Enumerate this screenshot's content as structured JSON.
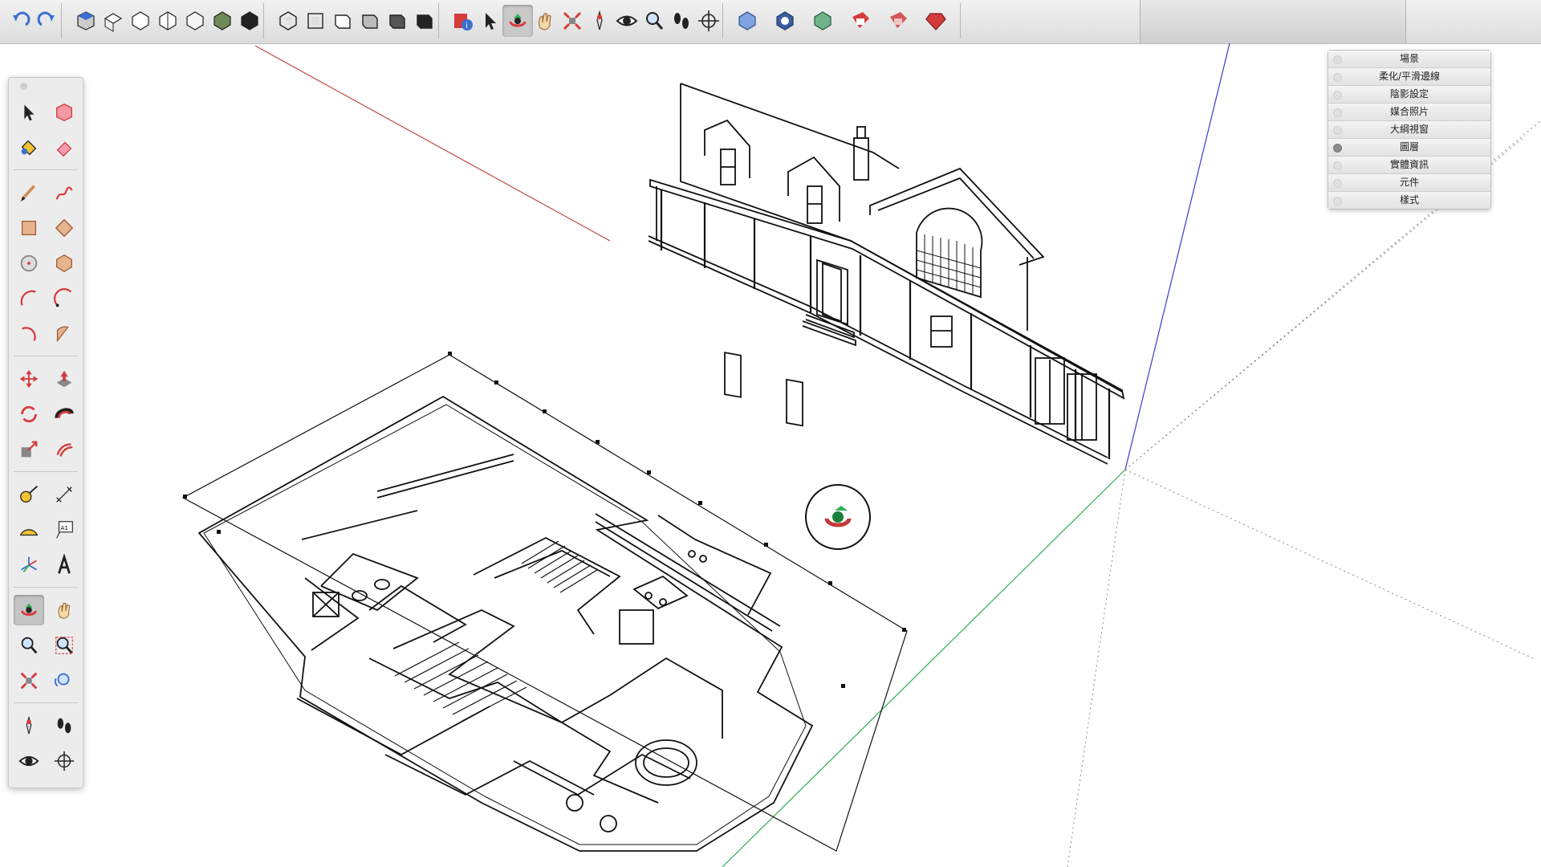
{
  "colors": {
    "red_axis": "#c04a4a",
    "green_axis": "#2fae55",
    "blue_axis": "#3a3ad0",
    "toolbar_bg": "#e2e2e2"
  },
  "toolbar": {
    "groups": [
      [
        "undo-icon",
        "redo-icon"
      ],
      [
        "iso-view-icon",
        "top-view-icon",
        "front-view-icon",
        "right-view-icon",
        "back-view-icon",
        "left-view-icon",
        "bottom-view-icon"
      ],
      [
        "x-ray-icon",
        "wireframe-icon",
        "hidden-line-icon",
        "shaded-icon",
        "shaded-textures-icon",
        "monochrome-icon"
      ],
      [
        "model-info-icon",
        "select-icon",
        "orbit-icon",
        "pan-icon",
        "zoom-extents-icon",
        "position-camera-icon",
        "look-around-icon",
        "zoom-icon",
        "walk-icon",
        "position-target-icon"
      ],
      [
        "3d-warehouse-icon",
        "share-model-icon",
        "extension-warehouse-icon",
        "layout-icon",
        "send-to-layout-icon",
        "ruby-console-icon"
      ],
      [
        "shadows-icon",
        "display-icon",
        "styles-icon",
        "fog-icon",
        "settings-icon",
        "components-icon",
        "tips-icon"
      ]
    ],
    "active": "orbit-icon"
  },
  "palette": {
    "rows": [
      [
        "select-icon",
        "make-component-icon"
      ],
      [
        "paint-bucket-icon",
        "eraser-icon"
      ],
      [
        "line-icon",
        "freehand-icon"
      ],
      [
        "rectangle-icon",
        "rotated-rectangle-icon"
      ],
      [
        "circle-icon",
        "polygon-icon"
      ],
      [
        "arc-icon",
        "two-point-arc-icon"
      ],
      [
        "three-point-arc-icon",
        "pie-icon"
      ],
      [
        "move-icon",
        "push-pull-icon"
      ],
      [
        "rotate-icon",
        "follow-me-icon"
      ],
      [
        "scale-icon",
        "offset-icon"
      ],
      [
        "tape-measure-icon",
        "dimension-icon"
      ],
      [
        "protractor-icon",
        "text-icon"
      ],
      [
        "axes-icon",
        "3d-text-icon"
      ],
      [
        "orbit-icon",
        "pan-icon"
      ],
      [
        "zoom-icon",
        "zoom-window-icon"
      ],
      [
        "zoom-extents-icon",
        "previous-view-icon"
      ],
      [
        "position-camera-icon",
        "walk-icon"
      ],
      [
        "look-around-icon",
        "section-plane-icon"
      ]
    ],
    "active": "orbit-icon"
  },
  "tray": {
    "items": [
      {
        "label": "場景",
        "active": false
      },
      {
        "label": "柔化/平滑邊線",
        "active": false
      },
      {
        "label": "陰影設定",
        "active": false
      },
      {
        "label": "媒合照片",
        "active": false
      },
      {
        "label": "大綱視窗",
        "active": false
      },
      {
        "label": "圖層",
        "active": true
      },
      {
        "label": "實體資訊",
        "active": false
      },
      {
        "label": "元件",
        "active": false
      },
      {
        "label": "樣式",
        "active": false
      }
    ]
  }
}
